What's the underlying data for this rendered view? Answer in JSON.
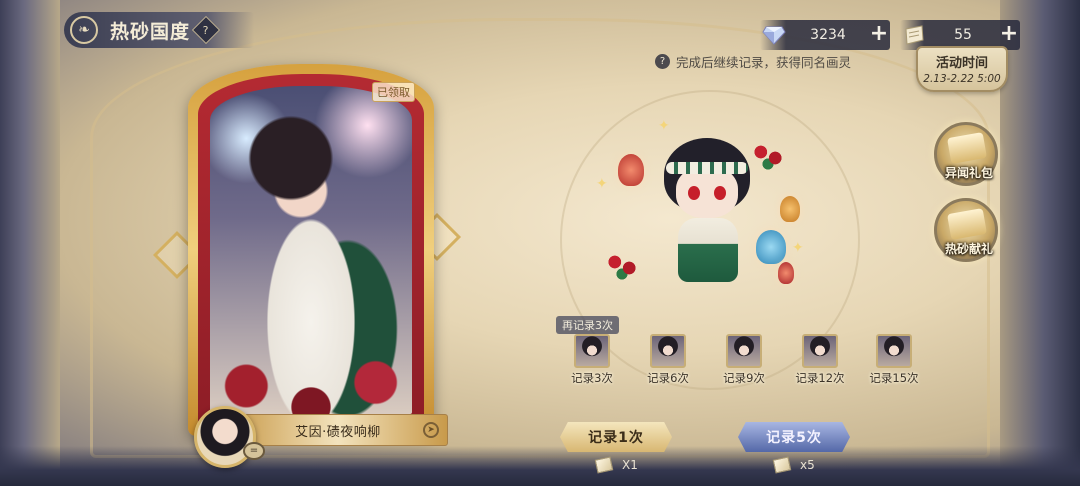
{
  "header": {
    "title": "热砂国度",
    "help_icon": "?"
  },
  "currency": {
    "gem_value": "3234",
    "ticket_value": "55",
    "plus": "+"
  },
  "hint": {
    "icon": "?",
    "text": "完成后继续记录，获得同名画灵"
  },
  "event": {
    "title": "活动时间",
    "dates": "2.13-2.22 5:00"
  },
  "side_buttons": {
    "pack_label": "异闻礼包",
    "gift_label": "热砂献礼"
  },
  "card": {
    "claimed_label": "已领取",
    "name": "艾因·碛夜响柳",
    "avatar_badge": "="
  },
  "milestones": {
    "again_label": "再记录3次",
    "items": [
      {
        "label": "记录3次"
      },
      {
        "label": "记录6次"
      },
      {
        "label": "记录9次"
      },
      {
        "label": "记录12次"
      },
      {
        "label": "记录15次"
      }
    ]
  },
  "actions": {
    "record_once": "记录1次",
    "record_five": "记录5次",
    "cost_once": "X1",
    "cost_five": "x5"
  },
  "colors": {
    "card_red": "#b42a32",
    "gold": "#d6a13e",
    "blue_button": "#5468a8"
  }
}
